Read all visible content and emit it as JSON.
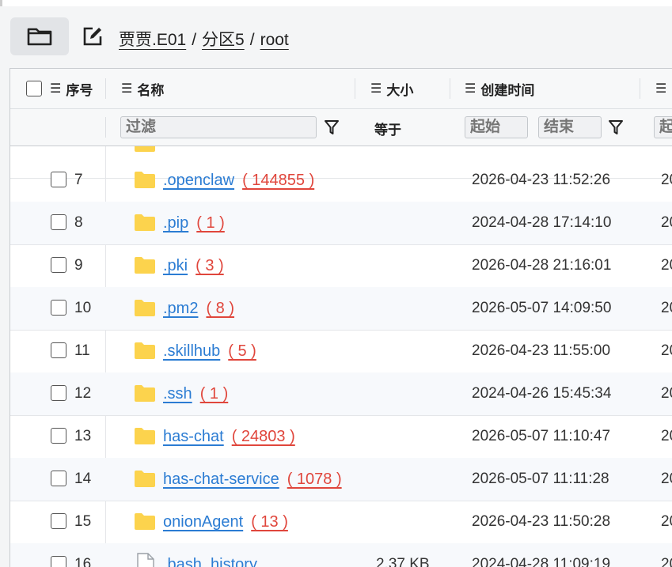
{
  "toolbar": {
    "breadcrumb": [
      "贾贾.E01",
      "分区5",
      "root"
    ],
    "separator": "/"
  },
  "header": {
    "seq_label": "序号",
    "name_label": "名称",
    "size_label": "大小",
    "created_label": "创建时间",
    "menu_glyph": "☰"
  },
  "filter": {
    "name_placeholder": "过滤",
    "size_op": "等于",
    "start_placeholder": "起始",
    "end_placeholder": "结束",
    "next_col_partial": "起"
  },
  "colors": {
    "link": "#2b7cd3",
    "count": "#e0463c",
    "folder": "#fcd34d"
  },
  "rows": [
    {
      "num": "7",
      "name": ".openclaw",
      "count": "( 144855 )",
      "size": "",
      "created": "2026-04-23 11:52:26",
      "next": "20",
      "type": "folder"
    },
    {
      "num": "8",
      "name": ".pip",
      "count": "( 1 )",
      "size": "",
      "created": "2024-04-28 17:14:10",
      "next": "20",
      "type": "folder"
    },
    {
      "num": "9",
      "name": ".pki",
      "count": "( 3 )",
      "size": "",
      "created": "2026-04-28 21:16:01",
      "next": "20",
      "type": "folder"
    },
    {
      "num": "10",
      "name": ".pm2",
      "count": "( 8 )",
      "size": "",
      "created": "2026-05-07 14:09:50",
      "next": "20",
      "type": "folder"
    },
    {
      "num": "11",
      "name": ".skillhub",
      "count": "( 5 )",
      "size": "",
      "created": "2026-04-23 11:55:00",
      "next": "20",
      "type": "folder"
    },
    {
      "num": "12",
      "name": ".ssh",
      "count": "( 1 )",
      "size": "",
      "created": "2024-04-26 15:45:34",
      "next": "20",
      "type": "folder"
    },
    {
      "num": "13",
      "name": "has-chat",
      "count": "( 24803 )",
      "size": "",
      "created": "2026-05-07 11:10:47",
      "next": "20",
      "type": "folder"
    },
    {
      "num": "14",
      "name": "has-chat-service",
      "count": "( 1078 )",
      "size": "",
      "created": "2026-05-07 11:11:28",
      "next": "20",
      "type": "folder"
    },
    {
      "num": "15",
      "name": "onionAgent",
      "count": "( 13 )",
      "size": "",
      "created": "2026-04-23 11:50:28",
      "next": "20",
      "type": "folder"
    },
    {
      "num": "16",
      "name": ".bash_history",
      "count": "",
      "size": "2.37 KB",
      "created": "2024-04-28 11:09:19",
      "next": "20",
      "type": "file"
    }
  ]
}
